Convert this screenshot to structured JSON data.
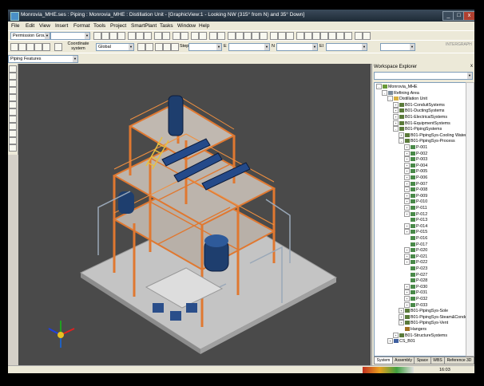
{
  "window": {
    "title": "Monrovia_MHE.ses : Piping : Monrovia_MHE : Distillation Unit - [GraphicView:1 - Looking NW (315° from N) and 35° Down]",
    "buttons": [
      "_",
      "□",
      "x"
    ]
  },
  "menu": [
    "File",
    "Edit",
    "View",
    "Insert",
    "Format",
    "Tools",
    "Project",
    "SmartPlant",
    "Tasks",
    "Window",
    "Help"
  ],
  "toolbar": {
    "permission_group": "Permission Group",
    "coordinate_system_label": "Coordinate system",
    "coordinate_system_value": "Global",
    "step_label": "Step:",
    "e_label": "E",
    "n_label": "N",
    "el_label": "El",
    "piping_features": "Piping Features",
    "watermark": "INTERGRAPH"
  },
  "explorer": {
    "title": "Workspace Explorer",
    "close": "x",
    "tree": [
      {
        "label": "Monrovia_MHE",
        "level": 0,
        "icon": "plant-icon",
        "exp": "-"
      },
      {
        "label": "Refining Area",
        "level": 1,
        "icon": "area-icon",
        "exp": "-"
      },
      {
        "label": "Distillation Unit",
        "level": 2,
        "icon": "folder-icon",
        "exp": "-"
      },
      {
        "label": "B01-ConduitSystems",
        "level": 3,
        "icon": "system-icon",
        "exp": "+"
      },
      {
        "label": "B01-DuctingSystems",
        "level": 3,
        "icon": "system-icon",
        "exp": "+"
      },
      {
        "label": "B01-ElectricalSystems",
        "level": 3,
        "icon": "system-icon",
        "exp": "+"
      },
      {
        "label": "B01-EquipmentSystems",
        "level": 3,
        "icon": "system-icon",
        "exp": "+"
      },
      {
        "label": "B01-PipingSystems",
        "level": 3,
        "icon": "system-icon",
        "exp": "-"
      },
      {
        "label": "B01-PipingSys-Cooling Water",
        "level": 4,
        "icon": "system-icon",
        "exp": "+"
      },
      {
        "label": "B01-PipingSys-Process",
        "level": 4,
        "icon": "system-icon",
        "exp": "-"
      },
      {
        "label": "P-001",
        "level": 5,
        "icon": "pipeline-icon",
        "exp": "+"
      },
      {
        "label": "P-002",
        "level": 5,
        "icon": "pipeline-icon",
        "exp": "+"
      },
      {
        "label": "P-003",
        "level": 5,
        "icon": "pipeline-icon",
        "exp": "+"
      },
      {
        "label": "P-004",
        "level": 5,
        "icon": "pipeline-icon",
        "exp": "+"
      },
      {
        "label": "P-005",
        "level": 5,
        "icon": "pipeline-icon",
        "exp": "+"
      },
      {
        "label": "P-006",
        "level": 5,
        "icon": "pipeline-icon",
        "exp": "+"
      },
      {
        "label": "P-007",
        "level": 5,
        "icon": "pipeline-icon",
        "exp": "+"
      },
      {
        "label": "P-008",
        "level": 5,
        "icon": "pipeline-icon",
        "exp": "+"
      },
      {
        "label": "P-009",
        "level": 5,
        "icon": "pipeline-icon",
        "exp": "+"
      },
      {
        "label": "P-010",
        "level": 5,
        "icon": "pipeline-icon",
        "exp": "+"
      },
      {
        "label": "P-011",
        "level": 5,
        "icon": "pipeline-icon",
        "exp": "+"
      },
      {
        "label": "P-012",
        "level": 5,
        "icon": "pipeline-icon",
        "exp": "+"
      },
      {
        "label": "P-013",
        "level": 5,
        "icon": "pipeline-icon",
        "exp": ""
      },
      {
        "label": "P-014",
        "level": 5,
        "icon": "pipeline-icon",
        "exp": "+"
      },
      {
        "label": "P-015",
        "level": 5,
        "icon": "pipeline-icon",
        "exp": "+"
      },
      {
        "label": "P-016",
        "level": 5,
        "icon": "pipeline-icon",
        "exp": ""
      },
      {
        "label": "P-017",
        "level": 5,
        "icon": "pipeline-icon",
        "exp": ""
      },
      {
        "label": "P-020",
        "level": 5,
        "icon": "pipeline-icon",
        "exp": "+"
      },
      {
        "label": "P-021",
        "level": 5,
        "icon": "pipeline-icon",
        "exp": "+"
      },
      {
        "label": "P-022",
        "level": 5,
        "icon": "pipeline-icon",
        "exp": "+"
      },
      {
        "label": "P-023",
        "level": 5,
        "icon": "pipeline-icon",
        "exp": ""
      },
      {
        "label": "P-027",
        "level": 5,
        "icon": "pipeline-icon",
        "exp": ""
      },
      {
        "label": "P-028",
        "level": 5,
        "icon": "pipeline-icon",
        "exp": ""
      },
      {
        "label": "P-030",
        "level": 5,
        "icon": "pipeline-icon",
        "exp": "+"
      },
      {
        "label": "P-031",
        "level": 5,
        "icon": "pipeline-icon",
        "exp": "+"
      },
      {
        "label": "P-032",
        "level": 5,
        "icon": "pipeline-icon",
        "exp": "+"
      },
      {
        "label": "P-033",
        "level": 5,
        "icon": "pipeline-icon",
        "exp": "+"
      },
      {
        "label": "B01-PipingSys-Sole",
        "level": 4,
        "icon": "system-icon",
        "exp": "+"
      },
      {
        "label": "B01-PipingSys-Steam&Condens",
        "level": 4,
        "icon": "system-icon",
        "exp": "+"
      },
      {
        "label": "B01-PipingSys-Vent",
        "level": 4,
        "icon": "system-icon",
        "exp": "+"
      },
      {
        "label": "Hangers",
        "level": 4,
        "icon": "hanger-icon",
        "exp": ""
      },
      {
        "label": "B01-StructureSystems",
        "level": 3,
        "icon": "system-icon",
        "exp": "+"
      },
      {
        "label": "CS_B01",
        "level": 2,
        "icon": "coord-icon",
        "exp": "+"
      }
    ],
    "tabs": [
      "System",
      "Assembly",
      "Space",
      "WBS",
      "Reference 3D"
    ]
  },
  "status": {
    "time": "16:03"
  },
  "colors": {
    "viewport_bg": "#4a4a4a",
    "steel": "#e07830",
    "grating": "#c8c8c8",
    "pipe_blue": "#2a4e8a",
    "titlebar": "#2a3a4a"
  }
}
